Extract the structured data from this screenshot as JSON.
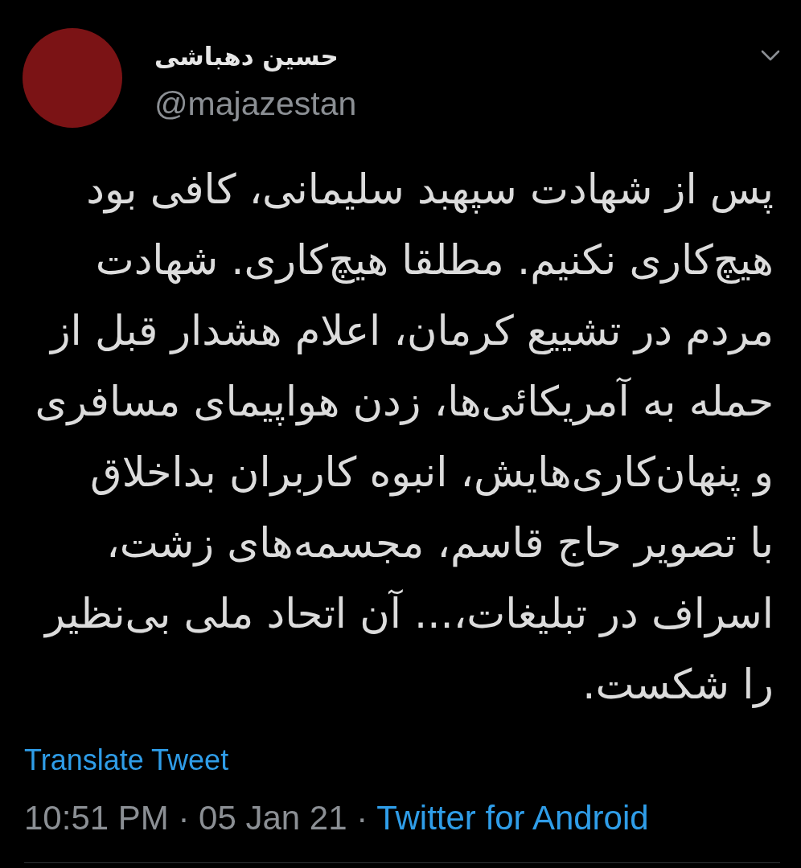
{
  "tweet": {
    "author": {
      "name": "حسین دهباشی",
      "handle": "@majazestan"
    },
    "text_lines": [
      "پس از شهادت سپهبد سلیمانی، کافی بود",
      "هیچ‌کاری نکنیم. مطلقا هیچ‌کاری. شهادت",
      "مردم در تشییع کرمان، اعلام هشدار قبل از",
      "حمله به آمریکائی‌ها، زدن هواپیمای مسافری",
      "و پنهان‌کاری‌هایش، انبوه کاربران بداخلاق",
      "با تصویر حاج قاسم، مجسمه‌های زشت،",
      "اسراف در تبلیغات،... آن اتحاد ملی بی‌نظیر",
      "را شکست."
    ],
    "translate_link": "Translate Tweet",
    "timestamp": "10:51 PM · 05 Jan 21 ·",
    "source": "Twitter for Android"
  }
}
